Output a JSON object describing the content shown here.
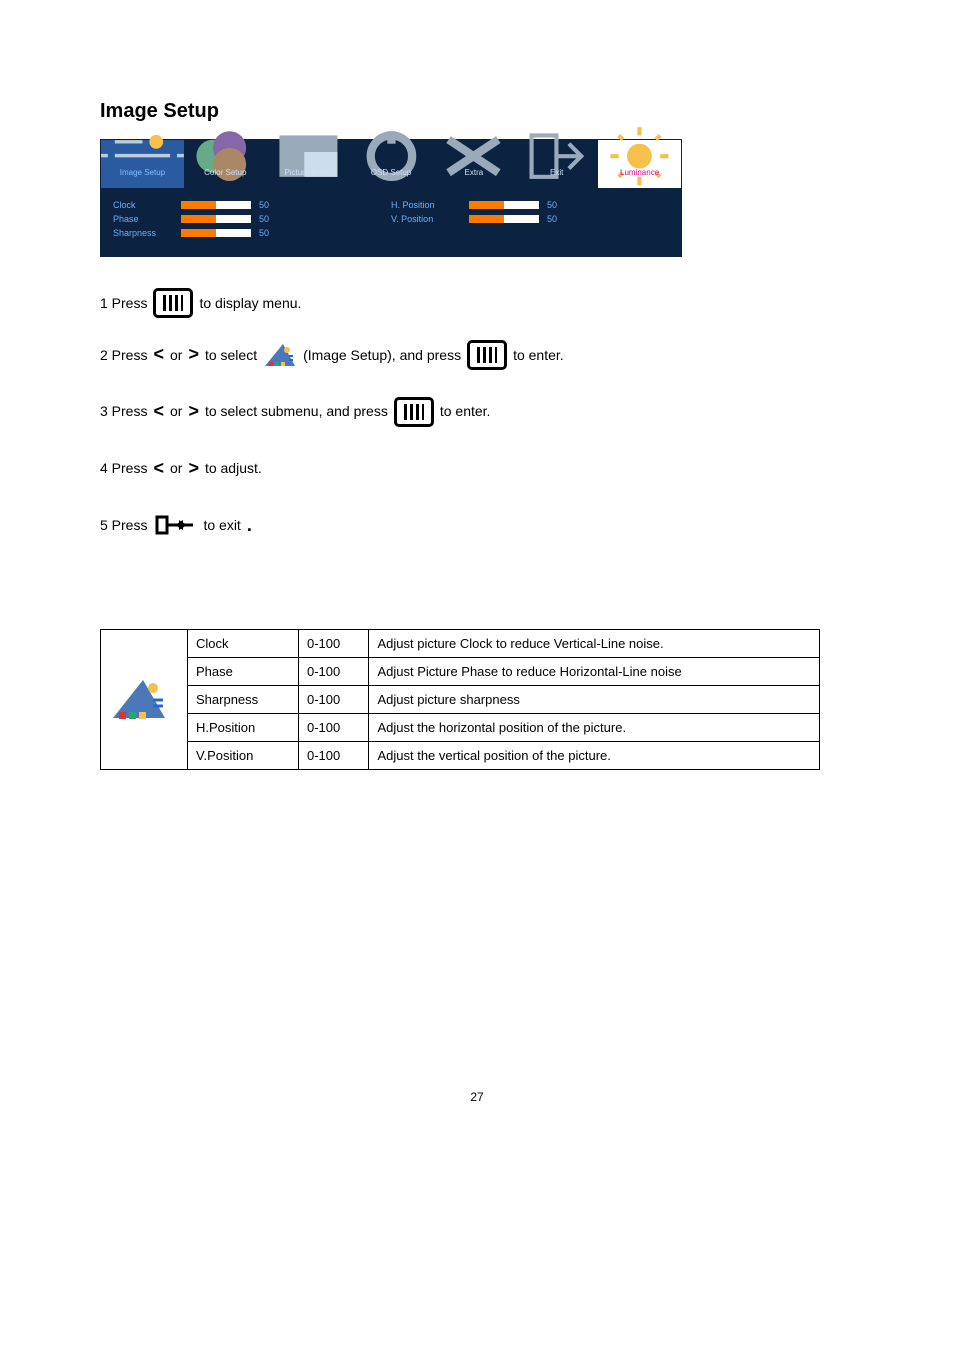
{
  "title": "Image Setup",
  "osd": {
    "tabs": [
      {
        "label": "Image Setup",
        "active": true
      },
      {
        "label": "Color Setup"
      },
      {
        "label": "Picture Boost"
      },
      {
        "label": "OSD Setup"
      },
      {
        "label": "Extra"
      },
      {
        "label": "Exit"
      },
      {
        "label": "Luminance"
      }
    ],
    "left": [
      {
        "label": "Clock",
        "value": "50",
        "pct": 50
      },
      {
        "label": "Phase",
        "value": "50",
        "pct": 50
      },
      {
        "label": "Sharpness",
        "value": "50",
        "pct": 50
      }
    ],
    "right": [
      {
        "label": "H. Position",
        "value": "50",
        "pct": 50
      },
      {
        "label": "V. Position",
        "value": "50",
        "pct": 50
      }
    ]
  },
  "steps": {
    "s1a": "1 Press",
    "s1b": "to display menu.",
    "s2a": "2 Press",
    "s2b": "or",
    "s2c": "to select",
    "s2d": "(Image Setup), and press",
    "s2e": "to enter.",
    "s3a": "3 Press",
    "s3b": "or",
    "s3c": "to select submenu, and press",
    "s3d": "to enter.",
    "s4a": "4 Press",
    "s4b": "or",
    "s4c": "to adjust.",
    "s5a": "5 Press",
    "s5b": "to exit",
    "s5c": "."
  },
  "table": {
    "rows": [
      {
        "name": "Clock",
        "range": "0-100",
        "desc": "Adjust picture Clock to reduce Vertical-Line noise."
      },
      {
        "name": "Phase",
        "range": "0-100",
        "desc": "Adjust Picture Phase to reduce Horizontal-Line noise"
      },
      {
        "name": "Sharpness",
        "range": "0-100",
        "desc": "Adjust picture sharpness"
      },
      {
        "name": "H.Position",
        "range": "0-100",
        "desc": "Adjust the horizontal position of the picture."
      },
      {
        "name": "V.Position",
        "range": "0-100",
        "desc": "Adjust the vertical position of the picture."
      }
    ]
  },
  "page_number": "27"
}
